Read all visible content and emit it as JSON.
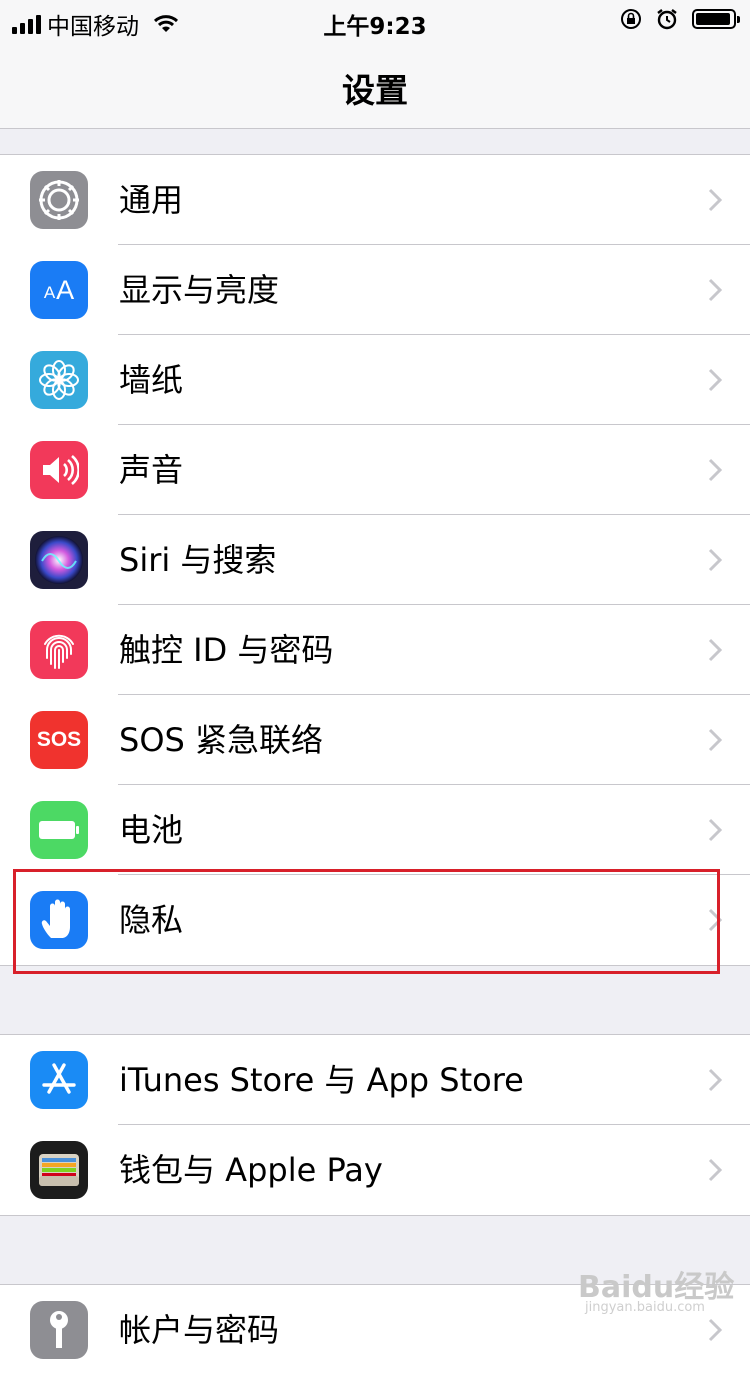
{
  "status": {
    "carrier": "中国移动",
    "time": "上午9:23"
  },
  "header": {
    "title": "设置"
  },
  "group1": [
    {
      "label": "通用",
      "icon": "gear-icon",
      "color": "#8e8e93"
    },
    {
      "label": "显示与亮度",
      "icon": "text-size-icon",
      "color": "#1a7cf5"
    },
    {
      "label": "墙纸",
      "icon": "flower-icon",
      "color": "#35aadc"
    },
    {
      "label": "声音",
      "icon": "speaker-icon",
      "color": "#f2395a"
    },
    {
      "label": "Siri 与搜索",
      "icon": "siri-icon",
      "color": "#1e1e3c"
    },
    {
      "label": "触控 ID 与密码",
      "icon": "fingerprint-icon",
      "color": "#f2395a"
    },
    {
      "label": "SOS 紧急联络",
      "icon": "sos-icon",
      "sos_text": "SOS",
      "color": "#f0332e"
    },
    {
      "label": "电池",
      "icon": "battery-icon",
      "color": "#4cd964"
    },
    {
      "label": "隐私",
      "icon": "hand-icon",
      "color": "#1a7cf5"
    }
  ],
  "group2": [
    {
      "label": "iTunes Store 与 App Store",
      "icon": "app-store-icon",
      "color": "#1a8bf5"
    },
    {
      "label": "钱包与 Apple Pay",
      "icon": "wallet-icon",
      "color": "#1c1c1c"
    }
  ],
  "group3": [
    {
      "label": "帐户与密码",
      "icon": "key-icon",
      "color": "#8e8e93"
    }
  ],
  "highlight_color": "#d8202a",
  "watermark": {
    "logo": "Baidu经验",
    "url": "jingyan.baidu.com"
  }
}
